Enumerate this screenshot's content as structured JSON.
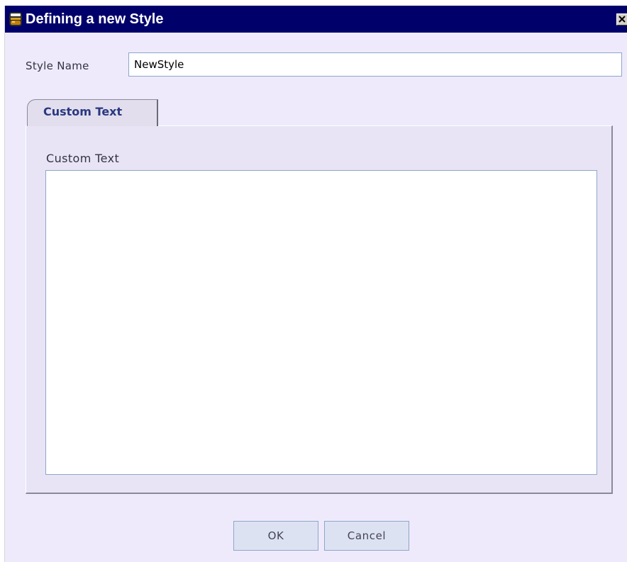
{
  "window": {
    "title": "Defining a new Style",
    "icon": "app-jar-icon",
    "close_icon": "close-icon"
  },
  "form": {
    "style_name_label": "Style Name",
    "style_name_value": "NewStyle"
  },
  "tabs": [
    {
      "label": "Custom Text",
      "selected": true
    }
  ],
  "panel": {
    "custom_text_label": "Custom Text",
    "custom_text_value": ""
  },
  "buttons": {
    "ok_label": "OK",
    "cancel_label": "Cancel"
  },
  "colors": {
    "titlebar": "#00006b",
    "dialog_background": "#eeeafc",
    "tab_text": "#2a3880",
    "input_border": "#8ea7c8",
    "button_background": "#dde2f2"
  }
}
